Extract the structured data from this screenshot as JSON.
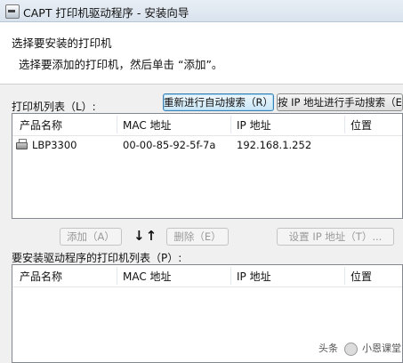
{
  "window": {
    "title": "CAPT 打印机驱动程序 - 安装向导",
    "icon": "printer-app-icon"
  },
  "header": {
    "heading": "选择要安装的打印机",
    "subheading": "选择要添加的打印机，然后单击 “添加”。"
  },
  "printer_list": {
    "label": "打印机列表（L）:",
    "auto_search_button": "重新进行自动搜索（R）",
    "manual_search_button": "按 IP 地址进行手动搜索（E）",
    "columns": [
      "产品名称",
      "MAC 地址",
      "IP 地址",
      "位置"
    ],
    "rows": [
      {
        "icon": "printer-icon",
        "name": "LBP3300",
        "mac": "00-00-85-92-5f-7a",
        "ip": "192.168.1.252",
        "location": ""
      }
    ]
  },
  "actions": {
    "add_button": "添加（A）",
    "arrows": "↓↑",
    "delete_button": "删除（E）",
    "set_ip_button": "设置 IP 地址（T）..."
  },
  "install_list": {
    "label": "要安装驱动程序的打印机列表（P）:",
    "columns": [
      "产品名称",
      "MAC 地址",
      "IP 地址",
      "位置"
    ],
    "rows": []
  },
  "watermark": {
    "text_left": "头条",
    "text_right": "小恩课堂"
  }
}
